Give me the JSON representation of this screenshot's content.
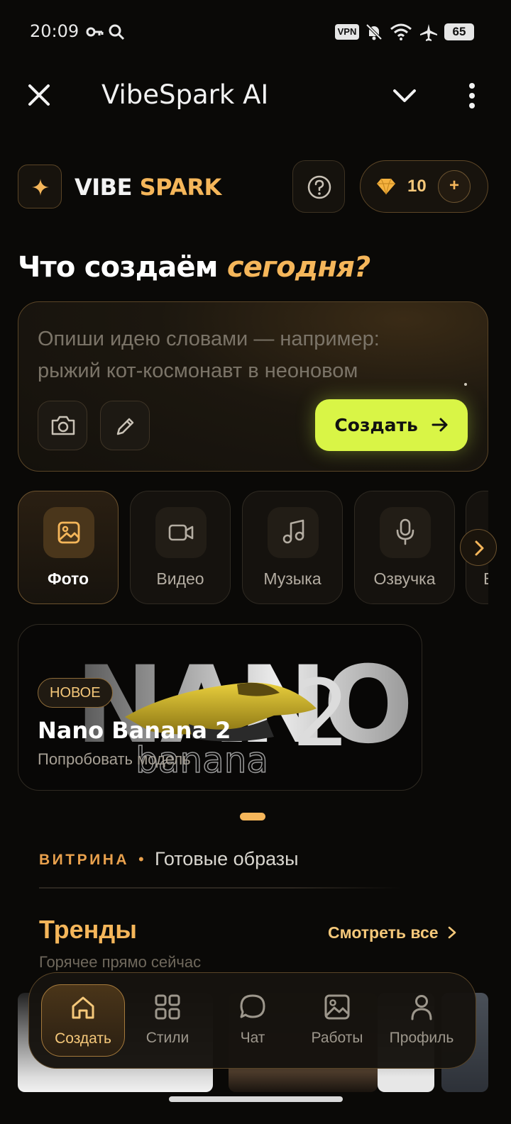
{
  "status_bar": {
    "time": "20:09",
    "icons": [
      "key-icon",
      "search-icon",
      "vpn-badge",
      "muted-bell-icon",
      "wifi-icon",
      "airplane-icon"
    ],
    "vpn_label": "VPN",
    "battery": "65"
  },
  "titlebar": {
    "title": "VibeSpark AI",
    "close_icon": "close-icon",
    "collapse_icon": "chevron-down-icon",
    "menu_icon": "more-vertical-icon"
  },
  "header": {
    "brand_part1": "VIBE",
    "brand_part2": "SPARK",
    "credits": "10",
    "plus": "+"
  },
  "heading": {
    "part1": "Что создаём",
    "part2": "сегодня?"
  },
  "prompt": {
    "placeholder": "Опиши идею словами — например: рыжий кот-космонавт в неоновом",
    "create_label": "Создать"
  },
  "categories": [
    {
      "label": "Фото",
      "icon": "image-icon",
      "active": true
    },
    {
      "label": "Видео",
      "icon": "video-camera-icon",
      "active": false
    },
    {
      "label": "Музыка",
      "icon": "music-note-icon",
      "active": false
    },
    {
      "label": "Озвучка",
      "icon": "microphone-icon",
      "active": false
    },
    {
      "label": "В",
      "icon": "",
      "active": false
    }
  ],
  "banner": {
    "badge": "НОВОЕ",
    "title": "Nano Banana 2",
    "subtitle": "Попробовать модель",
    "art_word": "NANO",
    "art_number": "2",
    "art_sub": "banana"
  },
  "showcase": {
    "kicker": "ВИТРИНА",
    "separator": "•",
    "title": "Готовые образы"
  },
  "trends": {
    "title": "Тренды",
    "see_all": "Смотреть все",
    "subtitle": "Горячее прямо сейчас"
  },
  "bottom_nav": [
    {
      "label": "Создать",
      "icon": "home-icon",
      "active": true
    },
    {
      "label": "Стили",
      "icon": "grid-icon",
      "active": false
    },
    {
      "label": "Чат",
      "icon": "chat-bubble-icon",
      "active": false
    },
    {
      "label": "Работы",
      "icon": "gallery-icon",
      "active": false
    },
    {
      "label": "Профиль",
      "icon": "user-icon",
      "active": false
    }
  ],
  "colors": {
    "accent": "#f5b65a",
    "create_button": "#d9f546",
    "background": "#0a0907"
  }
}
